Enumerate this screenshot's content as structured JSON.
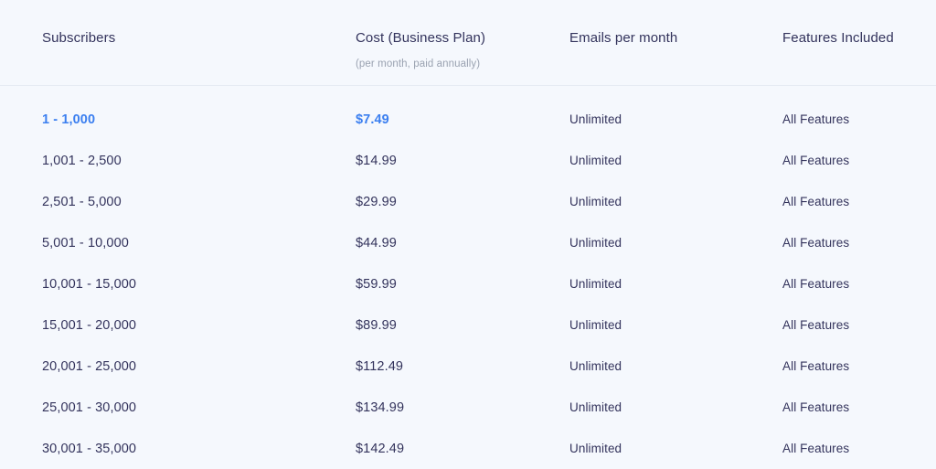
{
  "table": {
    "columns": [
      {
        "label": "Subscribers",
        "sublabel": ""
      },
      {
        "label": "Cost (Business Plan)",
        "sublabel": "(per month, paid annually)"
      },
      {
        "label": "Emails per month",
        "sublabel": ""
      },
      {
        "label": "Features Included",
        "sublabel": ""
      }
    ],
    "rows": [
      {
        "subscribers": "1 - 1,000",
        "cost": "$7.49",
        "emails": "Unlimited",
        "features": "All Features",
        "highlighted": true
      },
      {
        "subscribers": "1,001 - 2,500",
        "cost": "$14.99",
        "emails": "Unlimited",
        "features": "All Features",
        "highlighted": false
      },
      {
        "subscribers": "2,501 - 5,000",
        "cost": "$29.99",
        "emails": "Unlimited",
        "features": "All Features",
        "highlighted": false
      },
      {
        "subscribers": "5,001 - 10,000",
        "cost": "$44.99",
        "emails": "Unlimited",
        "features": "All Features",
        "highlighted": false
      },
      {
        "subscribers": "10,001 - 15,000",
        "cost": "$59.99",
        "emails": "Unlimited",
        "features": "All Features",
        "highlighted": false
      },
      {
        "subscribers": "15,001 - 20,000",
        "cost": "$89.99",
        "emails": "Unlimited",
        "features": "All Features",
        "highlighted": false
      },
      {
        "subscribers": "20,001 - 25,000",
        "cost": "$112.49",
        "emails": "Unlimited",
        "features": "All Features",
        "highlighted": false
      },
      {
        "subscribers": "25,001 - 30,000",
        "cost": "$134.99",
        "emails": "Unlimited",
        "features": "All Features",
        "highlighted": false
      },
      {
        "subscribers": "30,001 - 35,000",
        "cost": "$142.49",
        "emails": "Unlimited",
        "features": "All Features",
        "highlighted": false
      }
    ]
  },
  "colors": {
    "background": "#f5f8fd",
    "text": "#33335c",
    "muted": "#9aa2b1",
    "accent": "#3b7ff0",
    "divider": "#e6ebf3"
  }
}
